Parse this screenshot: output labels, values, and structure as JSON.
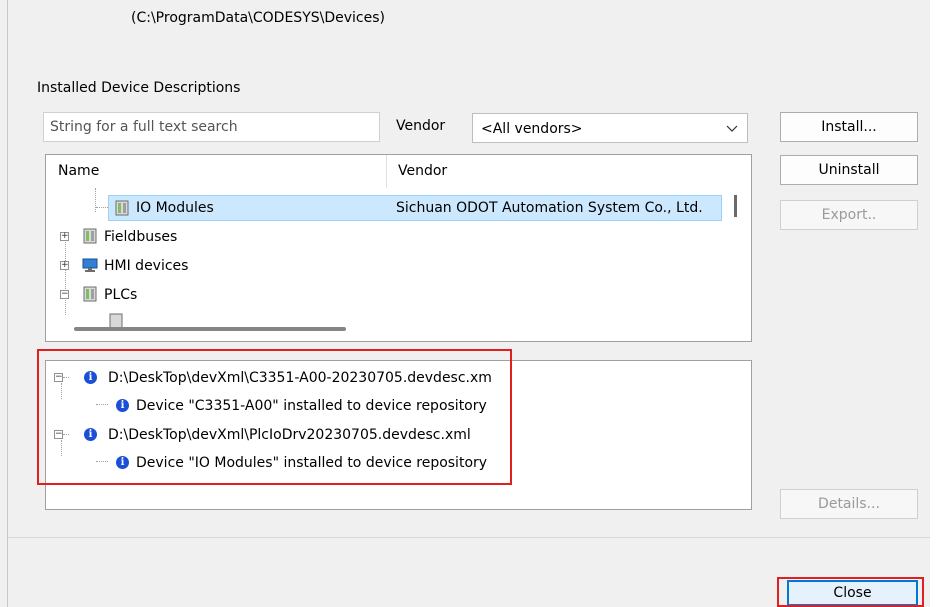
{
  "repository_path": "(C:\\ProgramData\\CODESYS\\Devices)",
  "section_title": "Installed Device Descriptions",
  "search": {
    "placeholder": "String for a full text search",
    "value": ""
  },
  "vendor_filter": {
    "label": "Vendor",
    "selected": "<All vendors>"
  },
  "buttons": {
    "install": "Install...",
    "uninstall": "Uninstall",
    "export": "Export..",
    "details": "Details...",
    "close": "Close"
  },
  "device_tree": {
    "columns": [
      "Name",
      "Vendor"
    ],
    "rows": [
      {
        "name": "IO Modules",
        "vendor": "Sichuan ODOT Automation System Co., Ltd.",
        "selected": true
      },
      {
        "name": "Fieldbuses",
        "vendor": ""
      },
      {
        "name": "HMI devices",
        "vendor": ""
      },
      {
        "name": "PLCs",
        "vendor": ""
      }
    ]
  },
  "messages": [
    {
      "text": "D:\\DeskTop\\devXml\\C3351-A00-20230705.devdesc.xm",
      "children": [
        "Device \"C3351-A00\" installed to device repository"
      ]
    },
    {
      "text": "D:\\DeskTop\\devXml\\PlcIoDrv20230705.devdesc.xml",
      "children": [
        "Device \"IO Modules\" installed to device repository"
      ]
    }
  ],
  "colors": {
    "selection": "#cce8ff",
    "highlight_box": "#e02020",
    "info_icon": "#1a4fd6"
  }
}
